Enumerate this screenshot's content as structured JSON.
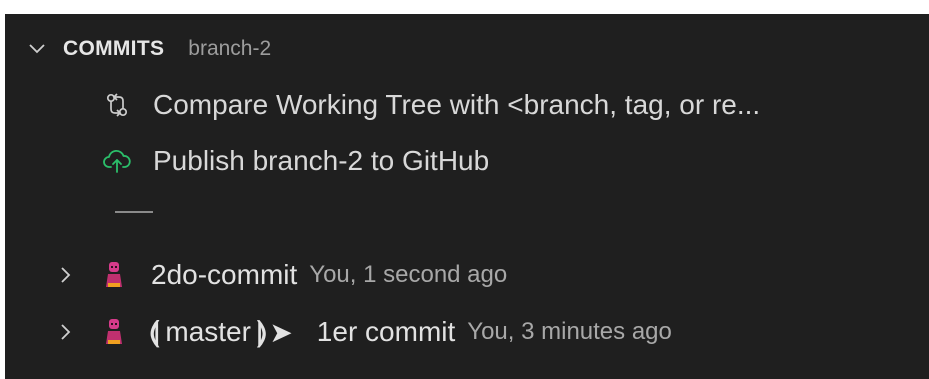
{
  "section": {
    "title": "COMMITS",
    "description": "branch-2"
  },
  "actions": [
    {
      "label": "Compare Working Tree with <branch, tag, or re...",
      "icon": "compare-changes-icon"
    },
    {
      "label": "Publish branch-2 to GitHub",
      "icon": "cloud-upload-icon"
    }
  ],
  "commits": [
    {
      "message": "2do-commit",
      "meta": "You, 1 second ago",
      "ref": ""
    },
    {
      "message": "1er commit",
      "meta": "You, 3 minutes ago",
      "ref": "master",
      "ref_open": "⟬",
      "ref_close": "⟭",
      "ref_arrow": "➤"
    }
  ],
  "colors": {
    "background": "#1f1f1f",
    "publish_icon": "#2bbf6a",
    "avatar": "#d63b8a"
  }
}
